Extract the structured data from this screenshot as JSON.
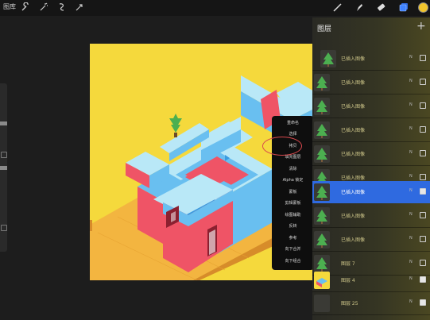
{
  "topbar": {
    "gallery_label": "图库",
    "tools": [
      "wrench-icon",
      "magic-wand-icon",
      "selection-icon",
      "transform-icon"
    ],
    "right_tools": [
      "brush-icon",
      "smudge-icon",
      "eraser-icon",
      "layers-icon"
    ],
    "color": "#f0c52d"
  },
  "actions_menu": {
    "items": [
      "重命名",
      "选择",
      "拷贝",
      "填充图层",
      "清除",
      "Alpha 锁定",
      "蒙板",
      "剪辑蒙板",
      "绘图辅助",
      "反转",
      "参考",
      "向下合并",
      "向下组合"
    ],
    "circled_item": "拷贝",
    "circle_color": "#d9494e"
  },
  "layers": {
    "title": "图层",
    "add_label": "+",
    "items": [
      {
        "name": "已插入图像",
        "mode": "N",
        "visible": false,
        "selected": false,
        "thumb": "tree"
      },
      {
        "name": "已插入图像",
        "mode": "N",
        "visible": false,
        "selected": false,
        "thumb": "tree"
      },
      {
        "name": "已插入图像",
        "mode": "N",
        "visible": false,
        "selected": false,
        "thumb": "tree"
      },
      {
        "name": "已插入图像",
        "mode": "N",
        "visible": false,
        "selected": false,
        "thumb": "tree"
      },
      {
        "name": "已插入图像",
        "mode": "N",
        "visible": false,
        "selected": false,
        "thumb": "tree"
      },
      {
        "name": "已插入图像",
        "mode": "N",
        "visible": false,
        "selected": false,
        "thumb": "tree"
      },
      {
        "name": "已插入图像",
        "mode": "N",
        "visible": true,
        "selected": true,
        "thumb": "tree"
      },
      {
        "name": "已插入图像",
        "mode": "N",
        "visible": false,
        "selected": false,
        "thumb": "tree"
      },
      {
        "name": "已插入图像",
        "mode": "N",
        "visible": false,
        "selected": false,
        "thumb": "tree"
      },
      {
        "name": "图层 7",
        "mode": "N",
        "visible": false,
        "selected": false,
        "thumb": "tree"
      },
      {
        "name": "图层 4",
        "mode": "N",
        "visible": true,
        "selected": false,
        "thumb": "art"
      },
      {
        "name": "图层 25",
        "mode": "N",
        "visible": true,
        "selected": false,
        "thumb": "empty"
      }
    ]
  },
  "canvas": {
    "background": "#f5d93c",
    "colors": {
      "red": "#ef5466",
      "blue": "#69bff0",
      "light_blue": "#b9e8f7",
      "orange": "#f3b540",
      "dark_orange": "#d78c2a",
      "green": "#4caf50"
    }
  }
}
